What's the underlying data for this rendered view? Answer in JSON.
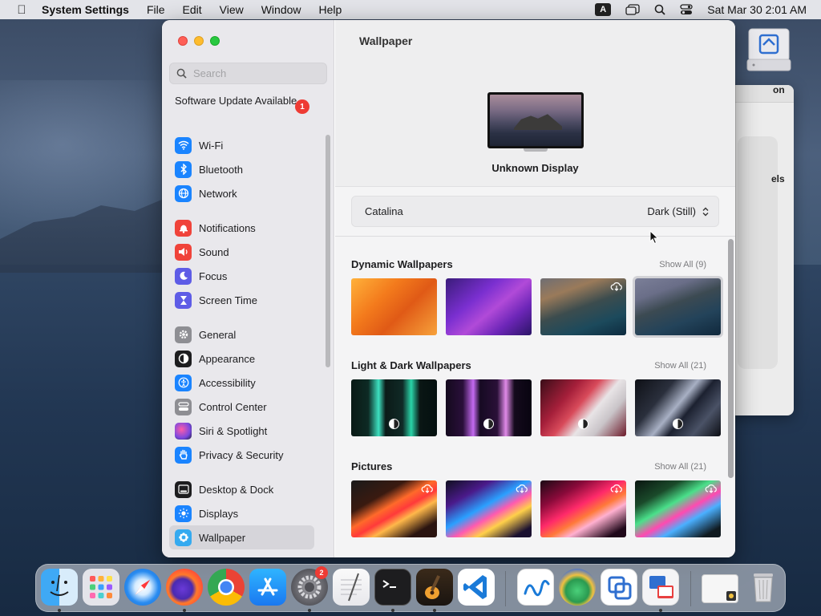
{
  "menubar": {
    "app_name": "System Settings",
    "menus": [
      "File",
      "Edit",
      "View",
      "Window",
      "Help"
    ],
    "input_source": "A",
    "clock": "Sat Mar 30  2:01 AM"
  },
  "background_window": {
    "title_fragment": "on",
    "text_fragment": "els"
  },
  "sidebar": {
    "search_placeholder": "Search",
    "software_update": "Software Update Available",
    "update_badge": "1",
    "items": [
      {
        "label": "Wi-Fi",
        "icon": "wifi-icon",
        "color": "#1a84ff"
      },
      {
        "label": "Bluetooth",
        "icon": "bluetooth-icon",
        "color": "#1a84ff"
      },
      {
        "label": "Network",
        "icon": "globe-icon",
        "color": "#1a84ff"
      },
      {
        "label": "Notifications",
        "icon": "bell-icon",
        "color": "#f0433a"
      },
      {
        "label": "Sound",
        "icon": "speaker-icon",
        "color": "#f0433a"
      },
      {
        "label": "Focus",
        "icon": "moon-icon",
        "color": "#5e5ce6"
      },
      {
        "label": "Screen Time",
        "icon": "hourglass-icon",
        "color": "#5e5ce6"
      },
      {
        "label": "General",
        "icon": "gear-icon",
        "color": "#8e8e93"
      },
      {
        "label": "Appearance",
        "icon": "appearance-icon",
        "color": "#1d1d1f"
      },
      {
        "label": "Accessibility",
        "icon": "accessibility-icon",
        "color": "#1a84ff"
      },
      {
        "label": "Control Center",
        "icon": "control-center-icon",
        "color": "#8e8e93"
      },
      {
        "label": "Siri & Spotlight",
        "icon": "siri-icon",
        "color": "#b44fd9"
      },
      {
        "label": "Privacy & Security",
        "icon": "hand-icon",
        "color": "#1a84ff"
      },
      {
        "label": "Desktop & Dock",
        "icon": "dock-icon",
        "color": "#1d1d1f"
      },
      {
        "label": "Displays",
        "icon": "sun-icon",
        "color": "#1a84ff"
      },
      {
        "label": "Wallpaper",
        "icon": "wallpaper-icon",
        "color": "#35aaf0"
      }
    ]
  },
  "content": {
    "title": "Wallpaper",
    "display_name": "Unknown Display",
    "wallpaper_name": "Catalina",
    "wallpaper_mode": "Dark (Still)",
    "sections": [
      {
        "title": "Dynamic Wallpapers",
        "show_all": "Show All (9)"
      },
      {
        "title": "Light & Dark Wallpapers",
        "show_all": "Show All (21)"
      },
      {
        "title": "Pictures",
        "show_all": "Show All (21)"
      }
    ]
  },
  "dock": {
    "apps": [
      "Finder",
      "Launchpad",
      "Safari",
      "Firefox",
      "Chrome",
      "App Store",
      "System Settings",
      "TextEdit",
      "Terminal",
      "GarageBand",
      "Visual Studio Code",
      "Freeform",
      "Preview",
      "Migration Assistant",
      "Screen Sharing",
      "Downloads",
      "Trash"
    ],
    "settings_badge": "2"
  }
}
